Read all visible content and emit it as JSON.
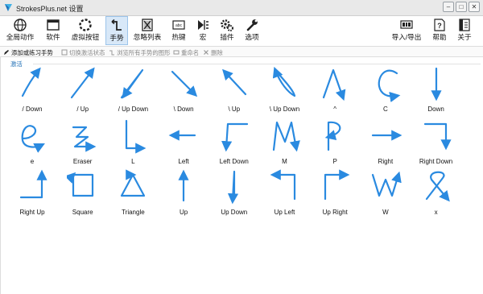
{
  "window": {
    "title": "StrokesPlus.net 设置",
    "controls": [
      "minimize",
      "maximize",
      "close"
    ]
  },
  "toolbar": {
    "buttons": [
      {
        "label": "全局动作",
        "icon": "globe-icon"
      },
      {
        "label": "软件",
        "icon": "window-icon"
      },
      {
        "label": "虚拟按钮",
        "icon": "dotted-circle-icon"
      },
      {
        "label": "手势",
        "icon": "gesture-icon",
        "active": true
      },
      {
        "label": "忽略列表",
        "icon": "ignore-list-icon"
      },
      {
        "label": "热键",
        "icon": "keyboard-icon"
      },
      {
        "label": "宏",
        "icon": "macro-icon"
      },
      {
        "label": "插件",
        "icon": "plugin-gear-icon"
      },
      {
        "label": "选项",
        "icon": "wrench-icon"
      }
    ],
    "right_buttons": [
      {
        "label": "导入/导出",
        "icon": "import-export-icon"
      },
      {
        "label": "帮助",
        "icon": "help-icon"
      },
      {
        "label": "关于",
        "icon": "about-icon"
      }
    ]
  },
  "subbar": {
    "add_practice": "添加或练习手势",
    "toggle_active": "切换激活状态",
    "browse_all": "浏览所有手势的图形",
    "rename": "重命名",
    "delete": "删除"
  },
  "group_label": "激活",
  "gestures": [
    {
      "label": "/ Down"
    },
    {
      "label": "/ Up"
    },
    {
      "label": "/ Up Down"
    },
    {
      "label": "\\ Down"
    },
    {
      "label": "\\ Up"
    },
    {
      "label": "\\ Up Down"
    },
    {
      "label": "^"
    },
    {
      "label": "C"
    },
    {
      "label": "Down"
    },
    {
      "label": "e"
    },
    {
      "label": "Eraser"
    },
    {
      "label": "L"
    },
    {
      "label": "Left"
    },
    {
      "label": "Left Down"
    },
    {
      "label": "M"
    },
    {
      "label": "P"
    },
    {
      "label": "Right"
    },
    {
      "label": "Right Down"
    },
    {
      "label": "Right Up"
    },
    {
      "label": "Square"
    },
    {
      "label": "Triangle"
    },
    {
      "label": "Up"
    },
    {
      "label": "Up Down"
    },
    {
      "label": "Up Left"
    },
    {
      "label": "Up Right"
    },
    {
      "label": "W"
    },
    {
      "label": "x"
    }
  ],
  "colors": {
    "stroke": "#2a8ae0",
    "accent_blue": "#1f6fb5",
    "active_bg": "#d8e8f8"
  }
}
